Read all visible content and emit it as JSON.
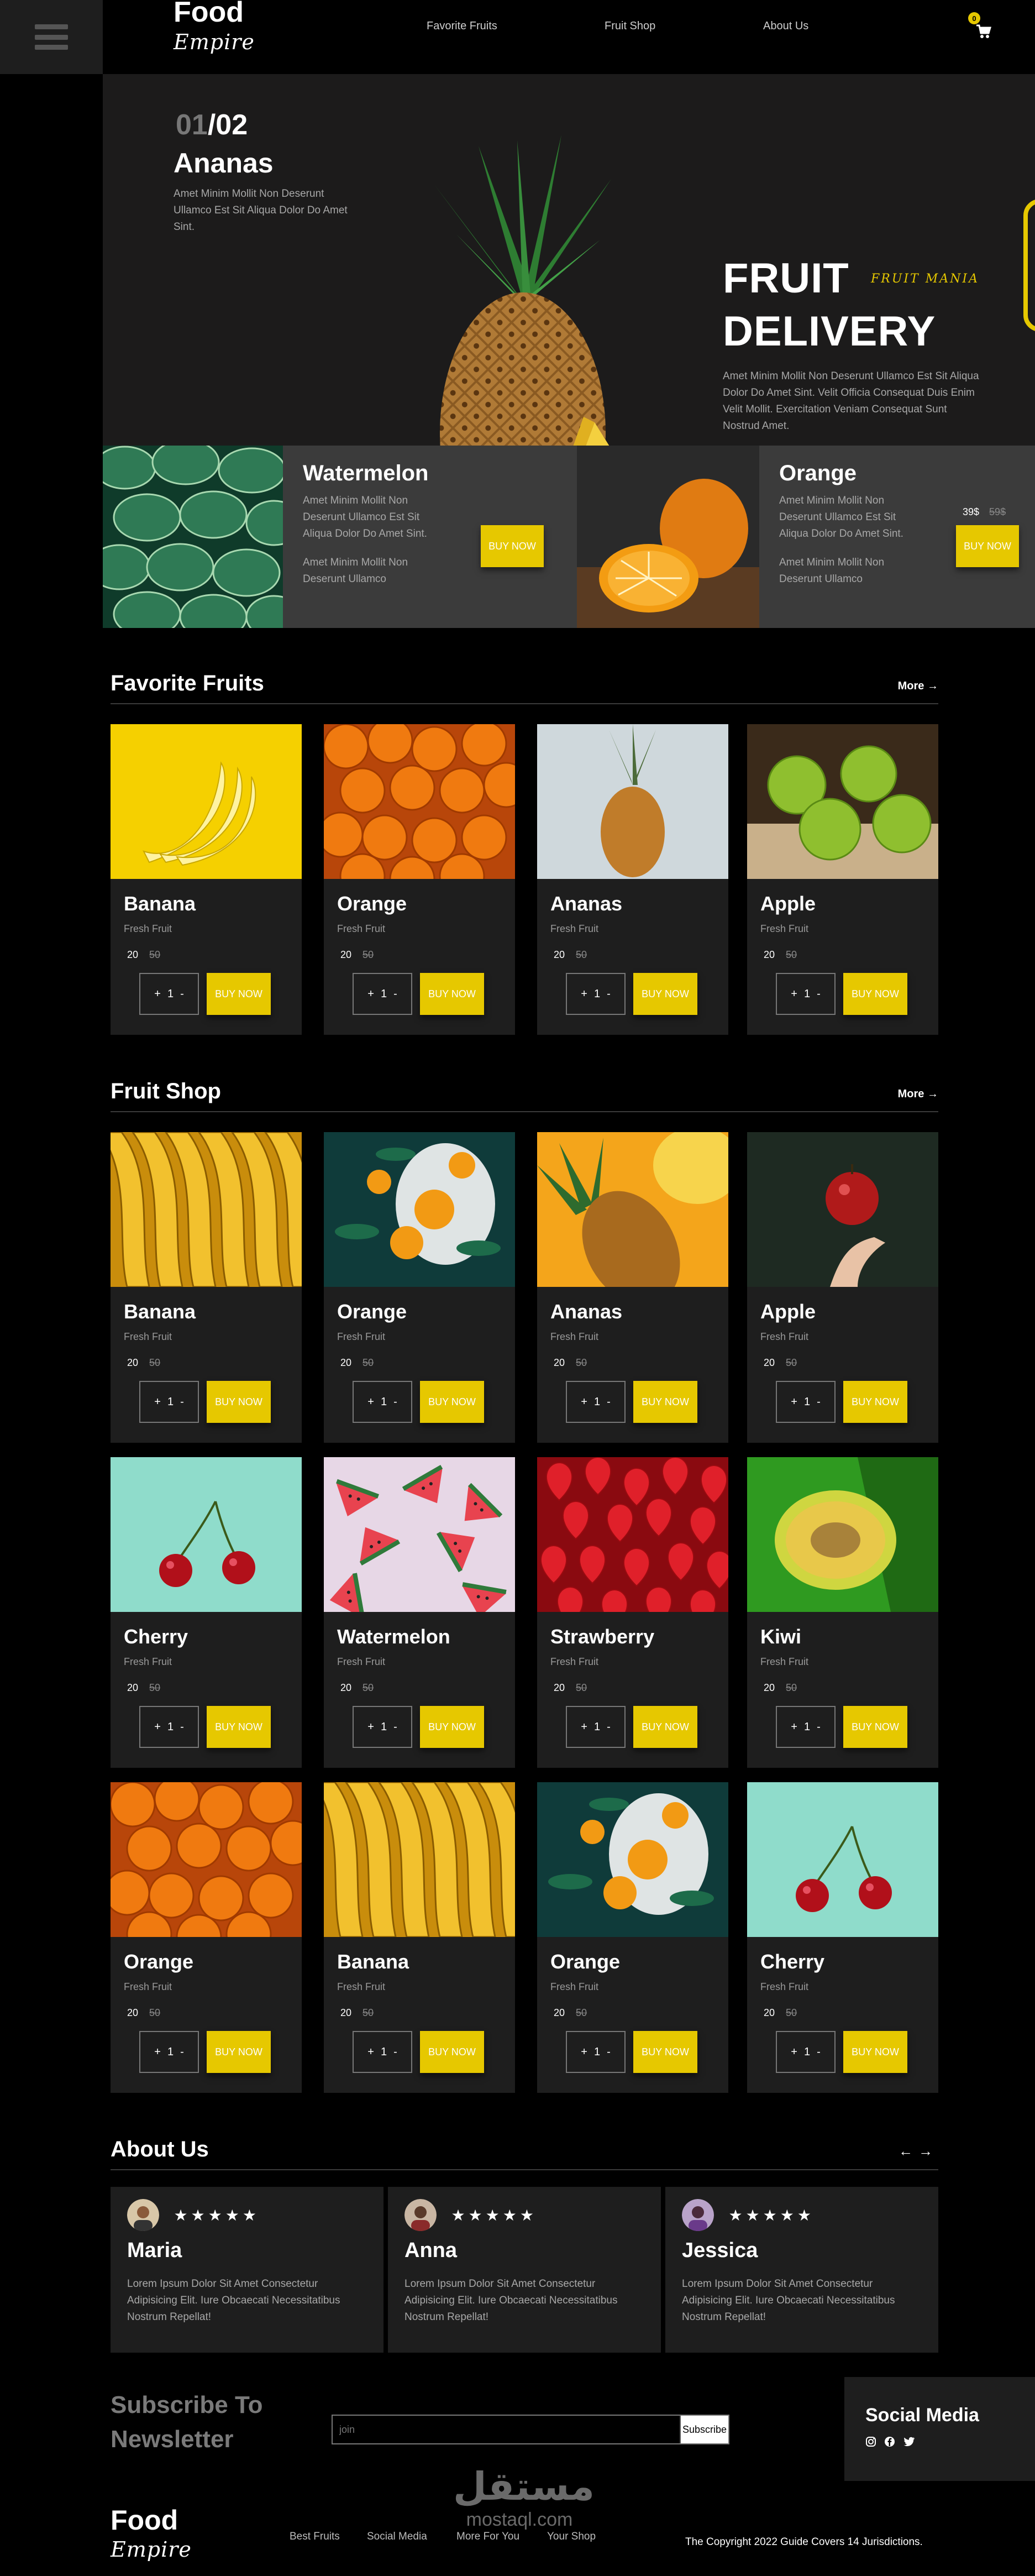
{
  "nav": {
    "logo_top": "Food",
    "logo_bottom": "Empire",
    "links": [
      "Favorite Fruits",
      "Fruit Shop",
      "About Us"
    ],
    "cart_count": "0"
  },
  "hero": {
    "slide_current": "01",
    "slide_total": "/02",
    "name": "Ananas",
    "description": "Amet Minim Mollit Non Deserunt Ullamco Est Sit Aliqua Dolor Do Amet Sint.",
    "headline_1": "FRUIT",
    "headline_2": "DELIVERY",
    "tagline": "FRUIT MANIA",
    "body": "Amet Minim Mollit Non Deserunt Ullamco Est Sit Aliqua Dolor Do Amet Sint. Velit Officia Consequat Duis Enim Velit Mollit. Exercitation Veniam Consequat Sunt Nostrud Amet.",
    "cards": [
      {
        "name": "Watermelon",
        "desc": "Amet Minim Mollit Non Deserunt Ullamco Est Sit Aliqua Dolor Do Amet Sint.",
        "desc2": "Amet Minim Mollit Non Deserunt Ullamco",
        "buy": "BUY NOW"
      },
      {
        "name": "Orange",
        "desc": "Amet Minim Mollit Non Deserunt Ullamco Est Sit Aliqua Dolor Do Amet Sint.",
        "desc2": "Amet Minim Mollit Non Deserunt Ullamco",
        "price": "39$",
        "old_price": "59$",
        "buy": "BUY NOW"
      }
    ]
  },
  "favorite": {
    "title": "Favorite Fruits",
    "more": "More",
    "products": [
      {
        "name": "Banana",
        "sub": "Fresh Fruit",
        "price": "20",
        "old": "50",
        "qty": "1",
        "buy": "BUY NOW"
      },
      {
        "name": "Orange",
        "sub": "Fresh Fruit",
        "price": "20",
        "old": "50",
        "qty": "1",
        "buy": "BUY NOW"
      },
      {
        "name": "Ananas",
        "sub": "Fresh Fruit",
        "price": "20",
        "old": "50",
        "qty": "1",
        "buy": "BUY NOW"
      },
      {
        "name": "Apple",
        "sub": "Fresh Fruit",
        "price": "20",
        "old": "50",
        "qty": "1",
        "buy": "BUY NOW"
      }
    ]
  },
  "shop": {
    "title": "Fruit Shop",
    "more": "More",
    "products": [
      {
        "name": "Banana",
        "sub": "Fresh Fruit",
        "price": "20",
        "old": "50",
        "qty": "1",
        "buy": "BUY NOW"
      },
      {
        "name": "Orange",
        "sub": "Fresh Fruit",
        "price": "20",
        "old": "50",
        "qty": "1",
        "buy": "BUY NOW"
      },
      {
        "name": "Ananas",
        "sub": "Fresh Fruit",
        "price": "20",
        "old": "50",
        "qty": "1",
        "buy": "BUY NOW"
      },
      {
        "name": "Apple",
        "sub": "Fresh Fruit",
        "price": "20",
        "old": "50",
        "qty": "1",
        "buy": "BUY NOW"
      },
      {
        "name": "Cherry",
        "sub": "Fresh Fruit",
        "price": "20",
        "old": "50",
        "qty": "1",
        "buy": "BUY NOW"
      },
      {
        "name": "Watermelon",
        "sub": "Fresh Fruit",
        "price": "20",
        "old": "50",
        "qty": "1",
        "buy": "BUY NOW"
      },
      {
        "name": "Strawberry",
        "sub": "Fresh Fruit",
        "price": "20",
        "old": "50",
        "qty": "1",
        "buy": "BUY NOW"
      },
      {
        "name": "Kiwi",
        "sub": "Fresh Fruit",
        "price": "20",
        "old": "50",
        "qty": "1",
        "buy": "BUY NOW"
      },
      {
        "name": "Orange",
        "sub": "Fresh Fruit",
        "price": "20",
        "old": "50",
        "qty": "1",
        "buy": "BUY NOW"
      },
      {
        "name": "Banana",
        "sub": "Fresh Fruit",
        "price": "20",
        "old": "50",
        "qty": "1",
        "buy": "BUY NOW"
      },
      {
        "name": "Orange",
        "sub": "Fresh Fruit",
        "price": "20",
        "old": "50",
        "qty": "1",
        "buy": "BUY NOW"
      },
      {
        "name": "Cherry",
        "sub": "Fresh Fruit",
        "price": "20",
        "old": "50",
        "qty": "1",
        "buy": "BUY NOW"
      }
    ]
  },
  "about": {
    "title": "About Us",
    "testimonials": [
      {
        "name": "Maria",
        "stars": "★★★★★",
        "text": "Lorem Ipsum Dolor Sit Amet Consectetur Adipisicing Elit. Iure Obcaecati Necessitatibus Nostrum Repellat!"
      },
      {
        "name": "Anna",
        "stars": "★★★★★",
        "text": "Lorem Ipsum Dolor Sit Amet Consectetur Adipisicing Elit. Iure Obcaecati Necessitatibus Nostrum Repellat!"
      },
      {
        "name": "Jessica",
        "stars": "★★★★★",
        "text": "Lorem Ipsum Dolor Sit Amet Consectetur Adipisicing Elit. Iure Obcaecati Necessitatibus Nostrum Repellat!"
      }
    ]
  },
  "newsletter": {
    "title_1": "Subscribe To",
    "title_2": "Newsletter",
    "placeholder": "join",
    "button": "Subscribe"
  },
  "social": {
    "title": "Social Media",
    "icons": [
      "instagram-icon",
      "facebook-icon",
      "twitter-icon"
    ]
  },
  "watermark": {
    "arabic": "مستقل",
    "latin": "mostaql.com"
  },
  "footer": {
    "logo_top": "Food",
    "logo_bottom": "Empire",
    "links": [
      "Best Fruits",
      "Social Media",
      "More For You",
      "Your Shop"
    ],
    "copyright": "The Copyright 2022 Guide Covers 14 Jurisdictions."
  },
  "colors": {
    "accent": "#e6c800",
    "panel": "#1e1e1e",
    "hero_bg": "#1c1b1b"
  }
}
